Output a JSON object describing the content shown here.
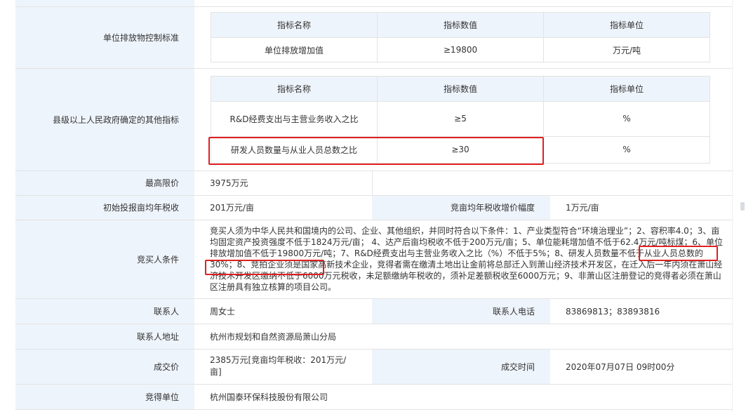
{
  "rows": {
    "emission": {
      "label": "单位排放物控制标准",
      "headers": [
        "指标名称",
        "指标数值",
        "指标单位"
      ],
      "row": [
        "单位排放增加值",
        "≥19800",
        "万元/吨"
      ]
    },
    "other": {
      "label": "县级以上人民政府确定的其他指标",
      "headers": [
        "指标名称",
        "指标数值",
        "指标单位"
      ],
      "rows": [
        [
          "R&D经费支出与主营业务收入之比",
          "≥5",
          "%"
        ],
        [
          "研发人员数量与从业人员总数之比",
          "≥30",
          "%"
        ]
      ]
    },
    "max_price": {
      "label": "最高限价",
      "value": "3975万元"
    },
    "tax": {
      "label": "初始投报亩均年税收",
      "value": "201万元/亩",
      "label2": "竞亩均年税收增价幅度",
      "value2": "1万元/亩"
    },
    "buyer": {
      "label": "竞买人条件",
      "text": "竞买人须为中华人民共和国境内的公司、企业、其他组织，并同时符合以下条件：1、产业类型符合“环境治理业”；2、容积率4.0；3、亩均固定资产投资强度不低于1824万元/亩； 4、达产后亩均税收不低于200万元/亩；5、单位能耗增加值不低于62.4万元/吨标煤；6、单位排放增加值不低于19800万元/吨；7、R&D经费支出与主营业务收入之比（%）不低于5%；8、研发人员数量不低于从业人员总数的30%；8、竞拍企业须是国家高新技术企业，竞得者需在缴清土地出让金前将总部迁入到萧山经济技术开发区，在迁入后一年内须在萧山经济技术开发区缴纳不低于6000万元税收，未足额缴纳年税收的，须补足差额税收至6000万元；9、非萧山区注册登记的竞得者必须在萧山区注册具有独立核算的项目公司。"
    },
    "contact": {
      "label": "联系人",
      "value": "周女士",
      "label2": "联系人电话",
      "value2": "83869813；83893816"
    },
    "address": {
      "label": "联系人地址",
      "value": "杭州市规划和自然资源局萧山分局"
    },
    "deal": {
      "label": "成交价",
      "value": "2385万元[竞亩均年税收：201万元/亩]",
      "label2": "成交时间",
      "value2": "2020年07月07日 09时00分"
    },
    "winner": {
      "label": "竞得单位",
      "value": "杭州国泰环保科技股份有限公司"
    }
  },
  "colors": {
    "label_bg": "#eef4fb",
    "border": "#e3e3e3",
    "highlight": "#e02020"
  }
}
